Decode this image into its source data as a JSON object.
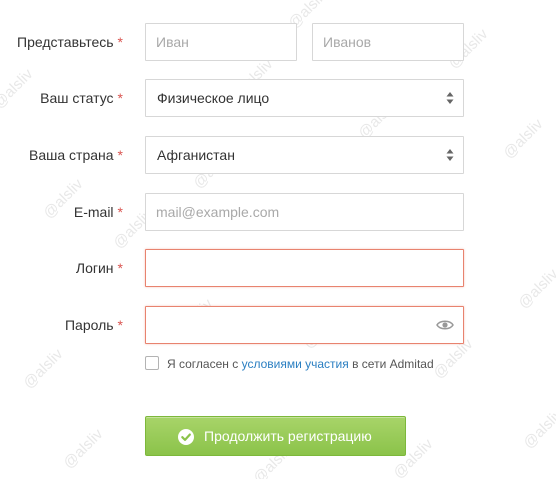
{
  "watermark": "@alsliv",
  "form": {
    "name": {
      "label": "Представьтесь",
      "required_mark": "*",
      "first_placeholder": "Иван",
      "last_placeholder": "Иванов"
    },
    "status": {
      "label": "Ваш статус",
      "required_mark": "*",
      "value": "Физическое лицо"
    },
    "country": {
      "label": "Ваша страна",
      "required_mark": "*",
      "value": "Афганистан"
    },
    "email": {
      "label": "E-mail",
      "required_mark": "*",
      "placeholder": "mail@example.com"
    },
    "login": {
      "label": "Логин",
      "required_mark": "*",
      "value": ""
    },
    "password": {
      "label": "Пароль",
      "required_mark": "*",
      "value": ""
    },
    "agreement": {
      "checked": false,
      "text_before": "Я согласен с ",
      "link_text": "условиями участия",
      "text_after": " в сети Admitad"
    },
    "submit": {
      "label": "Продолжить регистрацию"
    }
  },
  "colors": {
    "required": "#d9534f",
    "error_border": "#e8836f",
    "link": "#2b7fc2",
    "button": "#8bc34a"
  },
  "icons": {
    "select_arrows": "up-down-arrows-icon",
    "password_toggle": "eye-icon",
    "submit": "check-circle-icon"
  }
}
